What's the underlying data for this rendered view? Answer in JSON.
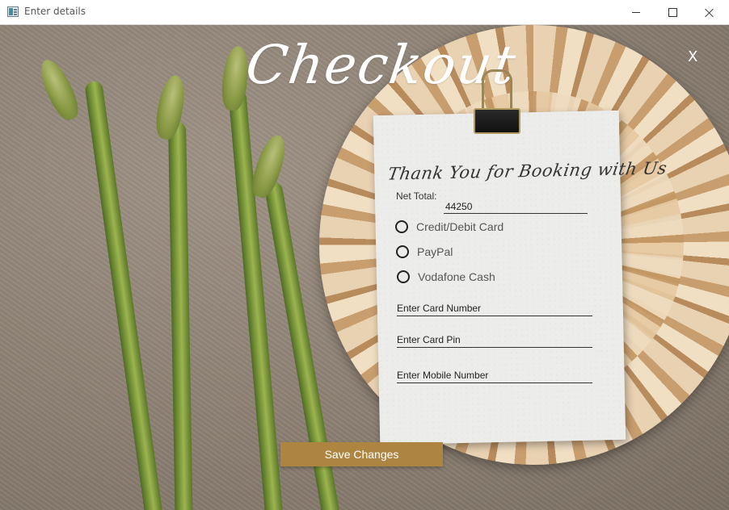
{
  "window": {
    "title": "Enter details",
    "icons": {
      "app": "app-window-icon",
      "minimize": "minimize-icon",
      "maximize": "maximize-icon",
      "close": "close-icon"
    }
  },
  "checkout": {
    "heading": "Checkout",
    "close_label": "X",
    "card": {
      "thanks_text": "Thank You for Booking with Us",
      "net_total_label": "Net Total:",
      "net_total_value": "44250",
      "payment_options": [
        {
          "label": "Credit/Debit Card",
          "selected": false
        },
        {
          "label": "PayPal",
          "selected": false
        },
        {
          "label": "Vodafone Cash",
          "selected": false
        }
      ],
      "card_number_placeholder": "Enter Card Number",
      "card_pin_placeholder": "Enter Card Pin",
      "mobile_number_placeholder": "Enter Mobile Number"
    },
    "save_button": "Save Changes"
  },
  "colors": {
    "accent": "#ae8540",
    "clip_gold": "#b19a5e",
    "card_bg": "#ececea",
    "text_dark": "#333333"
  }
}
